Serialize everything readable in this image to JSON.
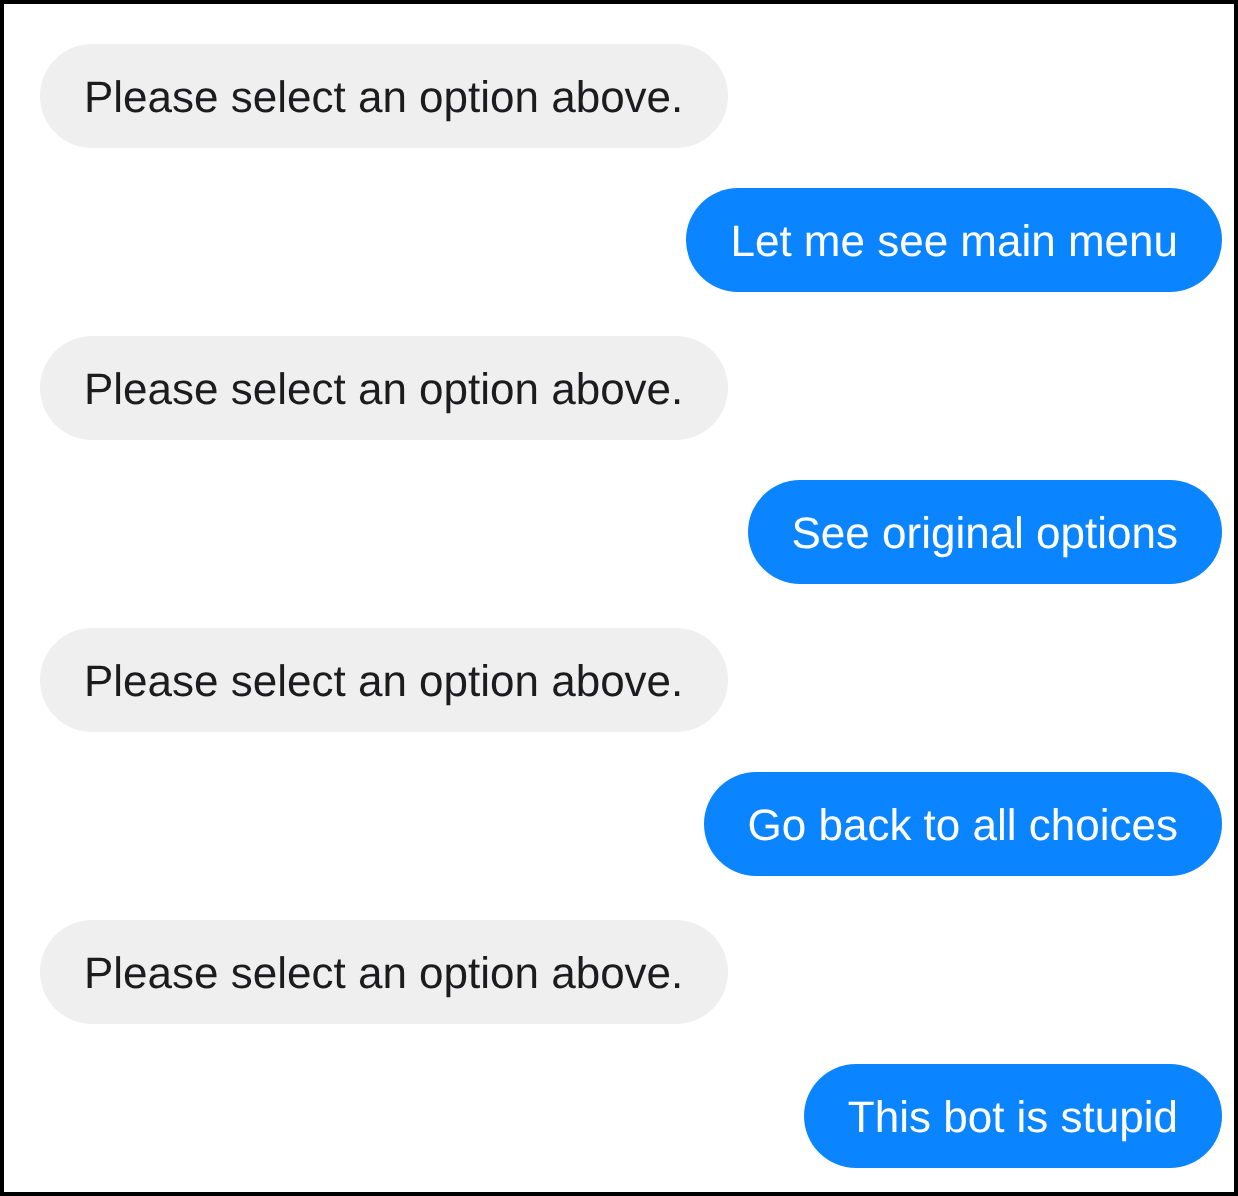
{
  "messages": [
    {
      "kind": "incoming",
      "text": "Please select an option above."
    },
    {
      "kind": "outgoing",
      "text": "Let me see main menu"
    },
    {
      "kind": "incoming",
      "text": "Please select an option above."
    },
    {
      "kind": "outgoing",
      "text": "See original options"
    },
    {
      "kind": "incoming",
      "text": "Please select an option above."
    },
    {
      "kind": "outgoing",
      "text": "Go back to all choices"
    },
    {
      "kind": "incoming",
      "text": "Please select an option above."
    },
    {
      "kind": "outgoing",
      "text": "This bot is stupid"
    }
  ]
}
